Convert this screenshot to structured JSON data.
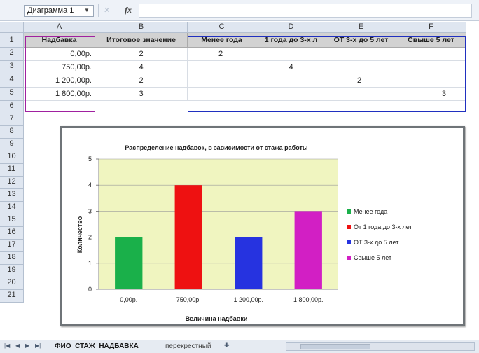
{
  "formula_bar": {
    "name_box": "Диаграмма 1",
    "fx": "fx"
  },
  "columns": [
    "A",
    "B",
    "C",
    "D",
    "E",
    "F"
  ],
  "rows": [
    "1",
    "2",
    "3",
    "4",
    "5",
    "6",
    "7",
    "8",
    "9",
    "10",
    "11",
    "12",
    "13",
    "14",
    "15",
    "16",
    "17",
    "18",
    "19",
    "20",
    "21"
  ],
  "table": {
    "headers": [
      "Надбавка",
      "Итоговое значение",
      "Менее года",
      "1 года до 3-х л",
      "ОТ 3-х до 5 лет",
      "Свыше 5 лет"
    ],
    "rows": [
      [
        "0,00р.",
        "2",
        "2",
        "",
        "",
        ""
      ],
      [
        "750,00р.",
        "4",
        "",
        "4",
        "",
        ""
      ],
      [
        "1 200,00р.",
        "2",
        "",
        "",
        "2",
        ""
      ],
      [
        "1 800,00р.",
        "3",
        "",
        "",
        "",
        "3"
      ]
    ]
  },
  "chart_data": {
    "type": "bar",
    "title": "Распределение надбавок, в зависимости от стажа работы",
    "xlabel": "Величина надбавки",
    "ylabel": "Количество",
    "categories": [
      "0,00р.",
      "750,00р.",
      "1 200,00р.",
      "1 800,00р."
    ],
    "series": [
      {
        "name": "Менее года",
        "values": [
          2,
          null,
          null,
          null
        ],
        "color": "#1ab04a"
      },
      {
        "name": "От 1 года до 3-х лет",
        "values": [
          null,
          4,
          null,
          null
        ],
        "color": "#ee1111"
      },
      {
        "name": "ОТ 3-х до 5 лет",
        "values": [
          null,
          null,
          2,
          null
        ],
        "color": "#2633e0"
      },
      {
        "name": "Свыше 5 лет",
        "values": [
          null,
          null,
          null,
          3
        ],
        "color": "#d21fc4"
      }
    ],
    "ylim": [
      0,
      5
    ],
    "yticks": [
      "0",
      "1",
      "2",
      "3",
      "4",
      "5"
    ],
    "grid": true,
    "plot_background": "#f0f5c0",
    "legend_position": "right"
  },
  "sheet_tabs": {
    "tab1": "ФИО_СТАЖ_НАДБАВКА",
    "tab2": "перекрестный"
  }
}
